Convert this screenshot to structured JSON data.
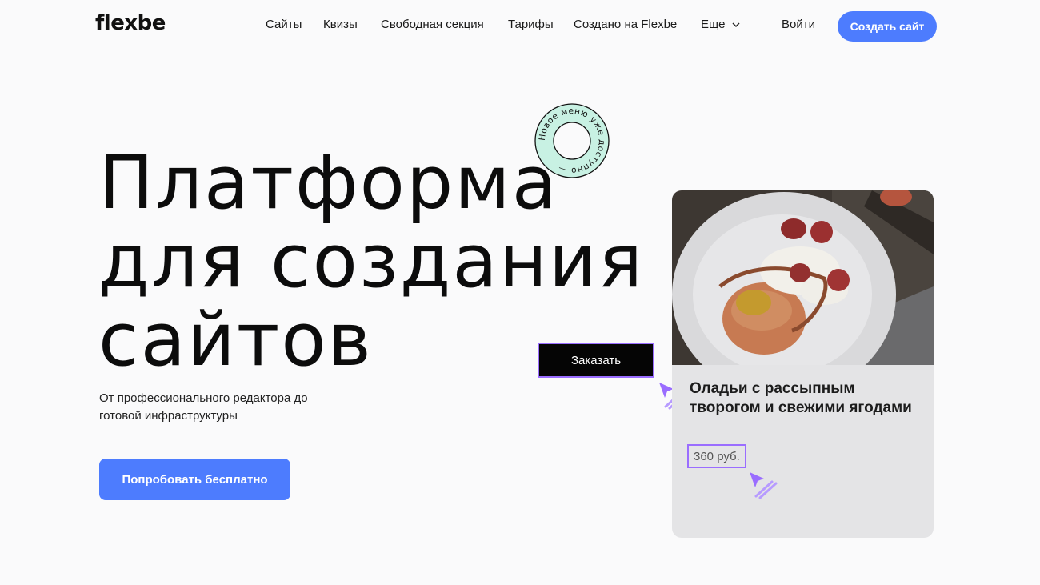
{
  "header": {
    "logo": "flexbe",
    "nav": [
      "Сайты",
      "Квизы",
      "Свободная секция",
      "Тарифы",
      "Создано на Flexbe",
      "Еще"
    ],
    "login": "Войти",
    "create_site": "Создать сайт"
  },
  "hero": {
    "title_lines": [
      "Платформа",
      "для создания",
      "сайтов"
    ],
    "subtitle": "От профессионального редактора до готовой инфраструктуры",
    "cta": "Попробовать бесплатно"
  },
  "badge": {
    "text": "Новое меню уже доступно — "
  },
  "demo": {
    "order_button": "Заказать",
    "dish_name": "Оладьи с рассыпным творогом и свежими ягодами",
    "price": "360 руб."
  },
  "colors": {
    "accent": "#4d7cfe",
    "highlight": "#9a6dff",
    "badge_bg": "#c8f1e3"
  },
  "icons": {
    "more": "chevron-down-icon",
    "pointer": "cursor-pointer-icon"
  }
}
